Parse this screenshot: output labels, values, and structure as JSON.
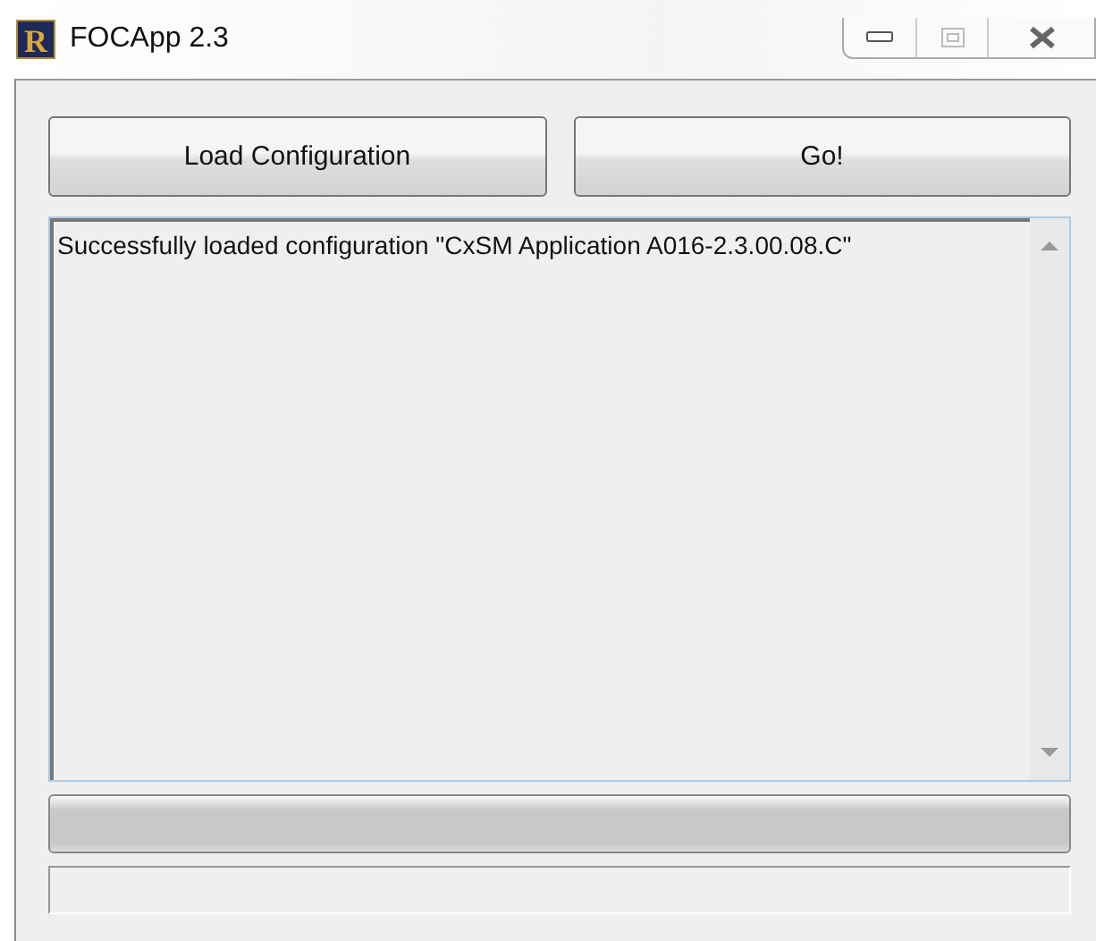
{
  "window": {
    "title": "FOCApp 2.3",
    "icon_letter": "R",
    "maximize_disabled": true
  },
  "buttons": [
    {
      "label": "Load Configuration"
    },
    {
      "label": "Go!"
    }
  ],
  "log": {
    "lines": [
      "Successfully loaded configuration \"CxSM Application A016-2.3.00.08.C\""
    ]
  },
  "progress": {
    "level": 0
  }
}
